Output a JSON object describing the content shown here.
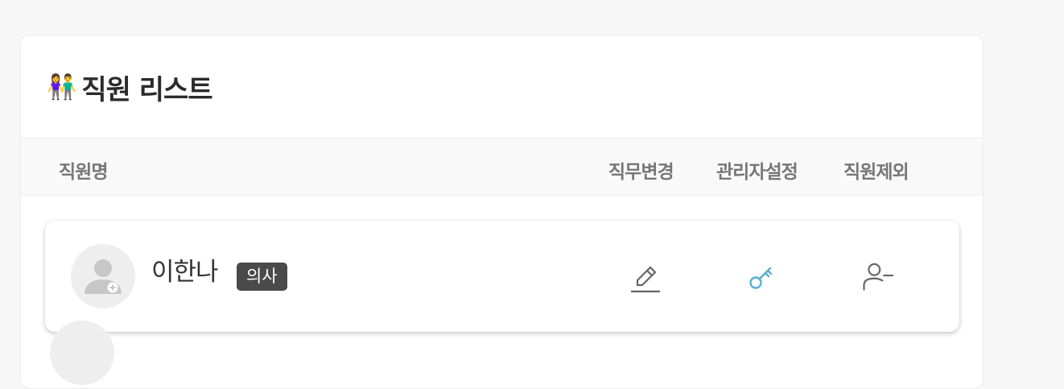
{
  "panel": {
    "title_emoji": "👫",
    "title": "직원 리스트"
  },
  "columns": {
    "name": "직원명",
    "role_change": "직무변경",
    "admin_setting": "관리자설정",
    "remove_staff": "직원제외"
  },
  "staff": [
    {
      "name": "이한나",
      "role": "의사",
      "avatar_icon": "doctor-avatar-icon",
      "actions": [
        "edit-pencil-icon",
        "key-icon",
        "user-minus-icon"
      ]
    }
  ],
  "colors": {
    "key_icon": "#5aaed3",
    "icon_gray": "#666666",
    "badge_bg": "#4a4a4a"
  }
}
